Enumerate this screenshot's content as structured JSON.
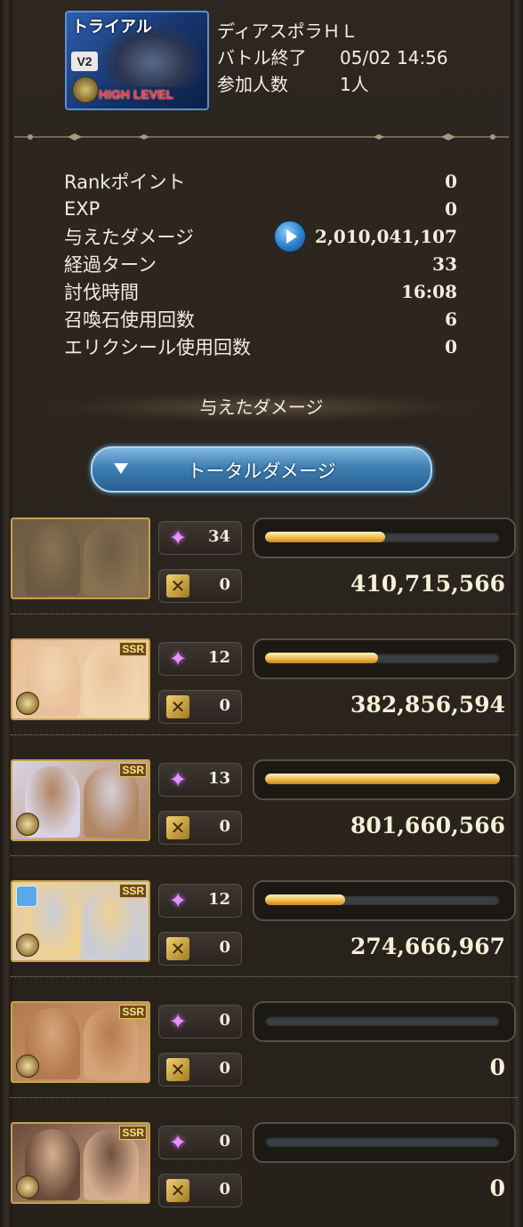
{
  "header": {
    "badge_trial": "トライアル",
    "badge_v2": "V2",
    "badge_level": "HIGH LEVEL",
    "quest_name": "ディアスポラＨＬ",
    "battle_end_label": "バトル終了",
    "battle_end_value": "05/02 14:56",
    "participants_label": "参加人数",
    "participants_value": "1人"
  },
  "stats": [
    {
      "label": "Rankポイント",
      "value": "0"
    },
    {
      "label": "EXP",
      "value": "0"
    },
    {
      "label": "与えたダメージ",
      "value": "2,010,041,107"
    },
    {
      "label": "経過ターン",
      "value": "33"
    },
    {
      "label": "討伐時間",
      "value": "16:08"
    },
    {
      "label": "召喚石使用回数",
      "value": "6"
    },
    {
      "label": "エリクシール使用回数",
      "value": "0"
    }
  ],
  "section_title": "与えたダメージ",
  "total_button_label": "トータルダメージ",
  "characters": [
    {
      "ougi": "34",
      "cross": "0",
      "damage": "410,715,566",
      "bar_fraction": 0.51,
      "ssr": "",
      "palette": [
        "#6b5a44",
        "#8a7250"
      ]
    },
    {
      "ougi": "12",
      "cross": "0",
      "damage": "382,856,594",
      "bar_fraction": 0.48,
      "ssr": "SSR",
      "palette": [
        "#e8c09a",
        "#f2d6b0"
      ]
    },
    {
      "ougi": "13",
      "cross": "0",
      "damage": "801,660,566",
      "bar_fraction": 1.0,
      "ssr": "SSR",
      "palette": [
        "#d9d4e2",
        "#b08460"
      ]
    },
    {
      "ougi": "12",
      "cross": "0",
      "damage": "274,666,967",
      "bar_fraction": 0.34,
      "ssr": "SSR",
      "palette": [
        "#f0d090",
        "#c8ccd8"
      ]
    },
    {
      "ougi": "0",
      "cross": "0",
      "damage": "0",
      "bar_fraction": 0,
      "ssr": "SSR",
      "palette": [
        "#b07a4c",
        "#d8a47a"
      ]
    },
    {
      "ougi": "0",
      "cross": "0",
      "damage": "0",
      "bar_fraction": 0,
      "ssr": "SSR",
      "palette": [
        "#6a4a3a",
        "#d8b090"
      ]
    }
  ],
  "icons": {
    "ougi": "star-icon",
    "cross": "chain-burst-icon",
    "play": "play-icon",
    "dropdown": "triangle-down-icon"
  }
}
